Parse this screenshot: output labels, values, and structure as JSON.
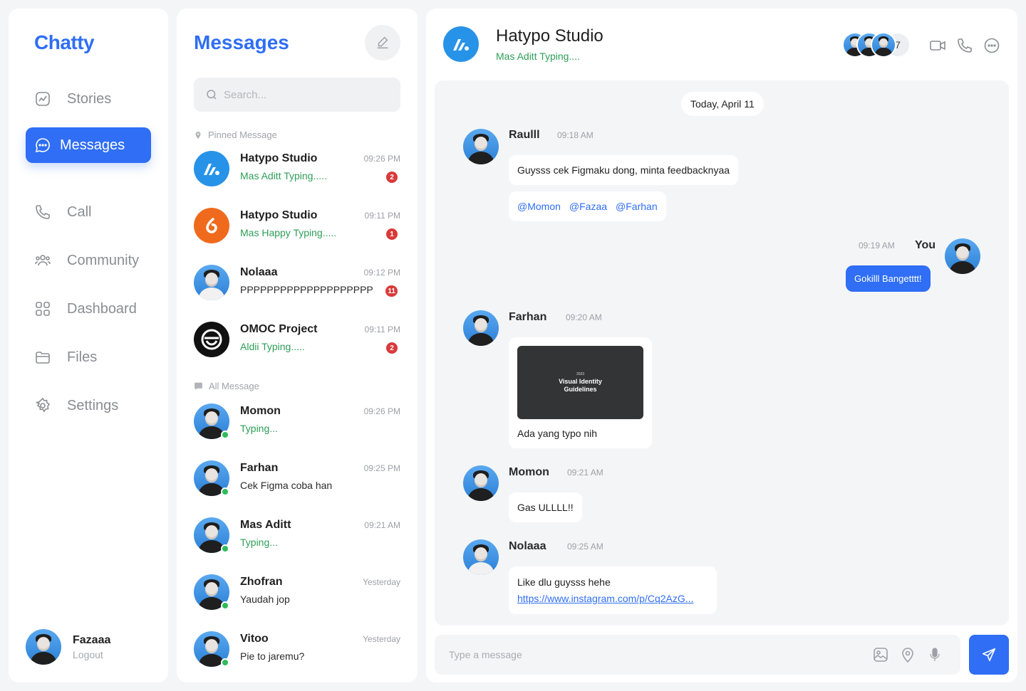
{
  "app": {
    "name": "Chatty"
  },
  "nav": {
    "items": [
      {
        "label": "Stories",
        "icon": "stories-icon",
        "active": false
      },
      {
        "label": "Messages",
        "icon": "chat-bubble-icon",
        "active": true
      },
      {
        "label": "Call",
        "icon": "phone-icon",
        "active": false
      },
      {
        "label": "Community",
        "icon": "users-icon",
        "active": false
      },
      {
        "label": "Dashboard",
        "icon": "grid-icon",
        "active": false
      },
      {
        "label": "Files",
        "icon": "folder-icon",
        "active": false
      },
      {
        "label": "Settings",
        "icon": "gear-icon",
        "active": false
      }
    ],
    "user": {
      "name": "Fazaaa",
      "logout": "Logout"
    }
  },
  "list": {
    "title": "Messages",
    "search_placeholder": "Search...",
    "pinned_label": "Pinned Message",
    "all_label": "All Message",
    "pinned": [
      {
        "name": "Hatypo Studio",
        "preview": "Mas Aditt Typing.....",
        "time": "09:26 PM",
        "badge": "2",
        "typing": true,
        "logo": "hatypo-logo-blue"
      },
      {
        "name": "Hatypo Studio",
        "preview": "Mas Happy Typing.....",
        "time": "09:11 PM",
        "badge": "1",
        "typing": true,
        "logo": "hatypo-logo-orange"
      },
      {
        "name": "Nolaaa",
        "preview": "PPPPPPPPPPPPPPPPPPPP",
        "time": "09:12 PM",
        "badge": "11",
        "typing": false,
        "logo": "avatar"
      },
      {
        "name": "OMOC Project",
        "preview": "Aldii Typing.....",
        "time": "09:11 PM",
        "badge": "2",
        "typing": true,
        "logo": "omoc-logo"
      }
    ],
    "all": [
      {
        "name": "Momon",
        "preview": "Typing...",
        "time": "09:26 PM",
        "typing": true,
        "online": true
      },
      {
        "name": "Farhan",
        "preview": "Cek Figma coba han",
        "time": "09:25 PM",
        "typing": false,
        "online": true
      },
      {
        "name": "Mas Aditt",
        "preview": "Typing...",
        "time": "09:21 AM",
        "typing": true,
        "online": true
      },
      {
        "name": "Zhofran",
        "preview": "Yaudah jop",
        "time": "Yesterday",
        "typing": false,
        "online": true
      },
      {
        "name": "Vitoo",
        "preview": "Pie to jaremu?",
        "time": "Yesterday",
        "typing": false,
        "online": true
      }
    ]
  },
  "chat": {
    "title": "Hatypo Studio",
    "subtitle": "Mas Aditt Typing....",
    "member_extra": "7",
    "date": "Today, April 11",
    "messages": [
      {
        "sender": "Raulll",
        "time": "09:18 AM",
        "text": "Guysss cek Figmaku dong, minta feedbacknyaa",
        "mentions": [
          "@Momon",
          "@Fazaa",
          "@Farhan"
        ]
      },
      {
        "sender": "You",
        "time": "09:19 AM",
        "text": "Gokilll Bangetttt!"
      },
      {
        "sender": "Farhan",
        "time": "09:20 AM",
        "image_year": "2023",
        "image_title": "Visual Identity Guidelines",
        "text": "Ada yang typo nih"
      },
      {
        "sender": "Momon",
        "time": "09:21 AM",
        "text": "Gas ULLLL!!"
      },
      {
        "sender": "Nolaaa",
        "time": "09:25 AM",
        "text": "Like dlu guysss hehe",
        "link": "https://www.instagram.com/p/Cq2AzG..."
      }
    ],
    "composer_placeholder": "Type a message"
  },
  "colors": {
    "accent": "#2f6ef5",
    "typing": "#2e9e58",
    "badge": "#d93a3a",
    "background": "#f4f5f7"
  }
}
